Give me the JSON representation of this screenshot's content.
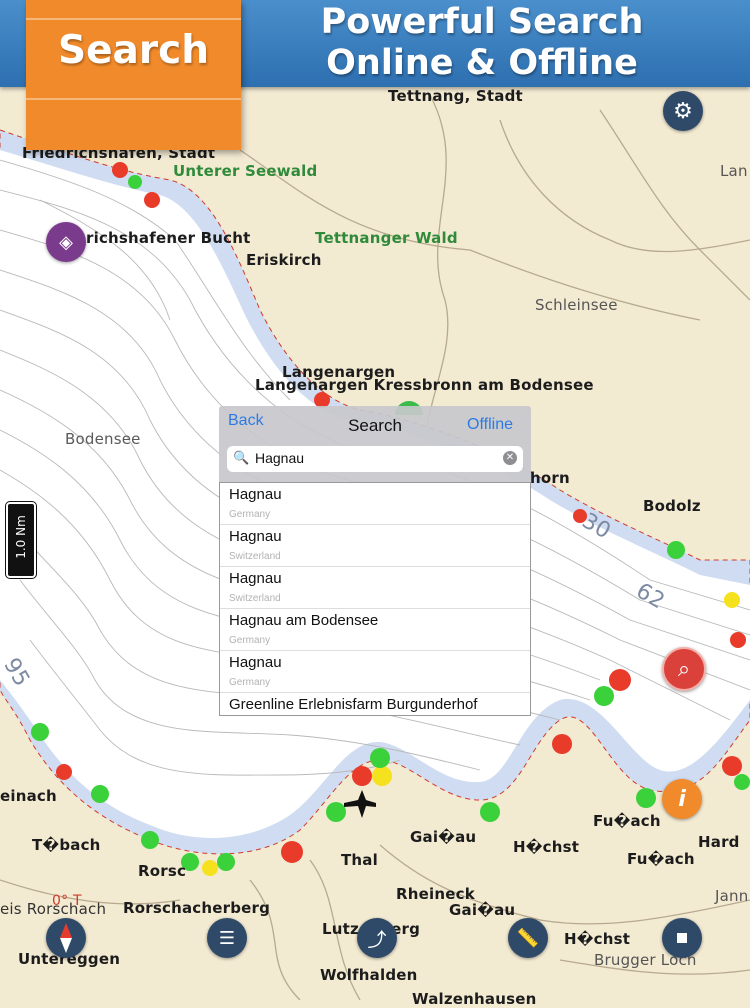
{
  "banner": {
    "tag": "Search",
    "headline_line1": "Powerful Search",
    "headline_line2": "Online & Offline"
  },
  "map_labels": {
    "tettnang": "Tettnang, Stadt",
    "friedrichshafen": "Friedrichshafen, Stadt",
    "unterer_seewald": "Unterer Seewald",
    "lan": "Lan",
    "bucht": "richshafener Bucht",
    "tettnanger_wald": "Tettnanger Wald",
    "eriskirch": "Eriskirch",
    "schleinsee": "Schleinsee",
    "langenargen1": "Langenargen",
    "langenargen2": "Langenargen Kressbronn am Bodensee",
    "bodensee": "Bodensee",
    "horn": "horn",
    "bodolz": "Bodolz",
    "depth_30": "30",
    "depth_62": "62",
    "depth_95": "95",
    "einach": "einach",
    "tobach": "T�bach",
    "rorsc": "Rorsc",
    "thal": "Thal",
    "gaiau1": "Gai�au",
    "hochst1": "H�chst",
    "fuach1": "Fu�ach",
    "fuach2": "Fu�ach",
    "hard": "Hard",
    "jann": "Jann",
    "heading": "0° T",
    "rorschach_kreis": "eis Rorschach",
    "rorschacherberg": "Rorschacherberg",
    "rheineck": "Rheineck",
    "gaiau2": "Gai�au",
    "lutzenberg": "Lutzenberg",
    "hochst2": "H�chst",
    "untereggen": "Untereggen",
    "wolfhalden": "Wolfhalden",
    "brugger_loch": "Brugger Loch",
    "walzenhausen": "Walzenhausen"
  },
  "scale_bar": {
    "label": "1.0 Nm"
  },
  "search": {
    "back_label": "Back",
    "title": "Search",
    "offline_label": "Offline",
    "query": "Hagnau",
    "results": [
      {
        "name": "Hagnau",
        "country": "Germany"
      },
      {
        "name": "Hagnau",
        "country": "Switzerland"
      },
      {
        "name": "Hagnau",
        "country": "Switzerland"
      },
      {
        "name": "Hagnau am Bodensee",
        "country": "Germany"
      },
      {
        "name": "Hagnau",
        "country": "Germany"
      },
      {
        "name": "Greenline Erlebnisfarm Burgunderhof",
        "country": ""
      }
    ]
  },
  "icons": {
    "settings": "gear-icon",
    "layers": "layers-icon",
    "search": "magnifier-icon",
    "info": "info-icon",
    "compass": "compass-icon",
    "favorites": "star-list-icon",
    "route": "route-icon",
    "measure": "ruler-icon",
    "record": "stop-icon"
  },
  "colors": {
    "banner_blue": "#2d6fb0",
    "tag_orange": "#f08a2a",
    "land": "#f3ead2",
    "shallow_water": "#cfdcf1",
    "deep_water": "#ffffff",
    "button_dark": "#2f4a68",
    "link_blue": "#2c7be5"
  }
}
